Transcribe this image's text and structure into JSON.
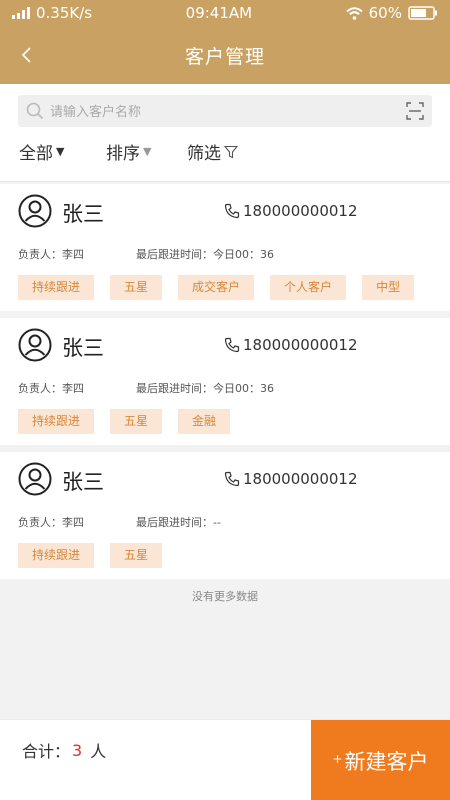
{
  "status_bar": {
    "network_speed": "0.35K/s",
    "time": "09:41AM",
    "battery": "60%"
  },
  "nav": {
    "title": "客户管理",
    "back_icon": "chevron-left-icon"
  },
  "search": {
    "placeholder": "请输入客户名称",
    "value": ""
  },
  "filters": [
    {
      "label": "全部",
      "indicator": "▼"
    },
    {
      "label": "排序",
      "indicator": "▼"
    },
    {
      "label": "筛选",
      "indicator": "filter-icon"
    }
  ],
  "customers": [
    {
      "name": "张三",
      "phone": "180000000012",
      "owner": "负责人：李四",
      "followup": "最后跟进时间：今日00：36",
      "tags": [
        "持续跟进",
        "五星",
        "成交客户",
        "个人客户",
        "中型"
      ]
    },
    {
      "name": "张三",
      "phone": "180000000012",
      "owner": "负责人：李四",
      "followup": "最后跟进时间：今日00：36",
      "tags": [
        "持续跟进",
        "五星",
        "金融"
      ]
    },
    {
      "name": "张三",
      "phone": "180000000012",
      "owner": "负责人：李四",
      "followup": "最后跟进时间：--",
      "tags": [
        "持续跟进",
        "五星"
      ]
    }
  ],
  "no_more": "没有更多数据",
  "footer": {
    "total_label": "合计：",
    "total_count": "3",
    "total_unit": "人",
    "new_button_plus": "+",
    "new_button_label": "新建客户"
  },
  "colors": {
    "header": "#c9a263",
    "tag_bg": "#fbe6d6",
    "tag_text": "#d5883a",
    "primary_button": "#f07b1f",
    "count": "#e0302b"
  }
}
